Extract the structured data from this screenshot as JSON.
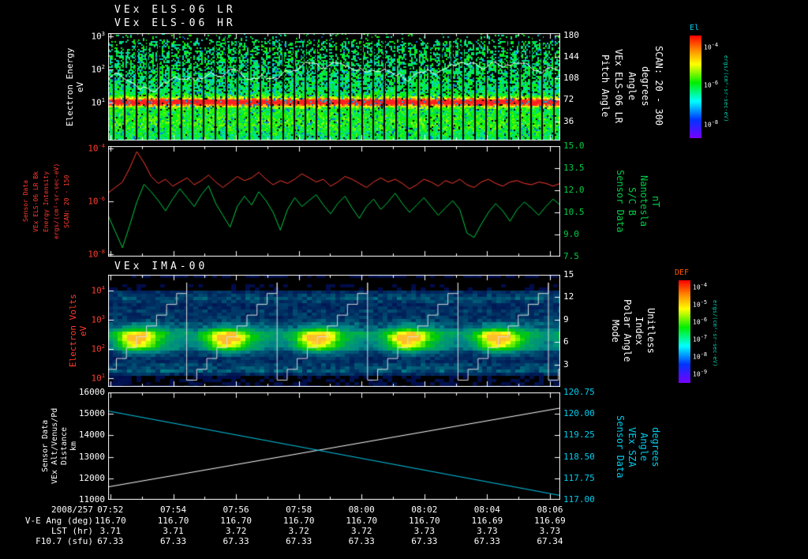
{
  "header": {
    "title_lr": "VEx ELS-06 LR",
    "title_hr": "VEx ELS-06 HR",
    "title_ima": "VEx IMA-00"
  },
  "colors": {
    "background": "#000000",
    "axis": "#ffffff",
    "red": "#ff3b2e",
    "green": "#00cc44",
    "cyan": "#00ccee",
    "def_title": "#ff5500"
  },
  "panels": {
    "p1": {
      "left_lines": [
        "Electron Energy",
        "eV"
      ],
      "right_lines": [
        "Pitch Angle",
        "VEx ELS-06 LR",
        "Angle",
        "degrees",
        "SCAN: 20 - 300"
      ],
      "left_ticks": [
        {
          "t": "10^3",
          "f": 0.03
        },
        {
          "t": "10^2",
          "f": 0.34
        },
        {
          "t": "10^1",
          "f": 0.65
        }
      ],
      "right_ticks": [
        {
          "t": "180",
          "f": 0.02
        },
        {
          "t": "144",
          "f": 0.22
        },
        {
          "t": "108",
          "f": 0.42
        },
        {
          "t": "72",
          "f": 0.62
        },
        {
          "t": "36",
          "f": 0.82
        }
      ]
    },
    "p2": {
      "left_lines": [
        "Sensor Data",
        "VEx ELS-06 LR Bk",
        "Energy Intensity",
        "ergs/(cm²-sr-sec-eV)",
        "SCAN: 20 - 150"
      ],
      "right_lines": [
        "Sensor Data",
        "S/C B",
        "Nanotesla",
        "nT"
      ],
      "left_ticks": [
        {
          "t": "10^-4",
          "f": 0.02
        },
        {
          "t": "10^-6",
          "f": 0.5
        },
        {
          "t": "10^-8",
          "f": 0.98
        }
      ],
      "right_ticks": [
        {
          "t": "15.0",
          "f": 0.0
        },
        {
          "t": "13.5",
          "f": 0.2
        },
        {
          "t": "12.0",
          "f": 0.4
        },
        {
          "t": "10.5",
          "f": 0.6
        },
        {
          "t": "9.0",
          "f": 0.8
        },
        {
          "t": "7.5",
          "f": 1.0
        }
      ]
    },
    "p3": {
      "left_lines": [
        "Electron Volts",
        "eV"
      ],
      "right_lines": [
        "Mode",
        "Polar Angle",
        "Index",
        "Unitless"
      ],
      "left_ticks": [
        {
          "t": "10^4",
          "f": 0.14
        },
        {
          "t": "10^3",
          "f": 0.4
        },
        {
          "t": "10^2",
          "f": 0.66
        },
        {
          "t": "10^1",
          "f": 0.92
        }
      ],
      "right_ticks": [
        {
          "t": "15",
          "f": 0.0
        },
        {
          "t": "12",
          "f": 0.2
        },
        {
          "t": "9",
          "f": 0.4
        },
        {
          "t": "6",
          "f": 0.6
        },
        {
          "t": "3",
          "f": 0.8
        }
      ]
    },
    "p4": {
      "left_lines": [
        "Sensor Data",
        "VEx Alt/Venus/Pd",
        "Distance",
        "km"
      ],
      "right_lines": [
        "Sensor Data",
        "VEx SZA",
        "Angle",
        "degrees"
      ],
      "left_ticks": [
        {
          "t": "16000",
          "f": 0.0
        },
        {
          "t": "15000",
          "f": 0.2
        },
        {
          "t": "14000",
          "f": 0.4
        },
        {
          "t": "13000",
          "f": 0.6
        },
        {
          "t": "12000",
          "f": 0.8
        },
        {
          "t": "11000",
          "f": 1.0
        }
      ],
      "right_ticks": [
        {
          "t": "120.75",
          "f": 0.0
        },
        {
          "t": "120.00",
          "f": 0.2
        },
        {
          "t": "119.25",
          "f": 0.4
        },
        {
          "t": "118.50",
          "f": 0.6
        },
        {
          "t": "117.75",
          "f": 0.8
        },
        {
          "t": "117.00",
          "f": 1.0
        }
      ]
    }
  },
  "colorbars": {
    "el": {
      "title": "El",
      "unit": "ergs/(cm²-sr-sec-eV)",
      "ticks": [
        {
          "t": "10^-4",
          "f": 0.1
        },
        {
          "t": "10^-6",
          "f": 0.47
        },
        {
          "t": "10^-8",
          "f": 0.85
        }
      ]
    },
    "def": {
      "title": "DEF",
      "unit": "ergs/(cm²-sr-sec-eV)",
      "ticks": [
        {
          "t": "10^-4",
          "f": 0.05
        },
        {
          "t": "10^-5",
          "f": 0.22
        },
        {
          "t": "10^-6",
          "f": 0.39
        },
        {
          "t": "10^-7",
          "f": 0.56
        },
        {
          "t": "10^-8",
          "f": 0.73
        },
        {
          "t": "10^-9",
          "f": 0.9
        }
      ]
    }
  },
  "time_axis": {
    "date": "2008/257",
    "ticks": [
      "07:52",
      "07:54",
      "07:56",
      "07:58",
      "08:00",
      "08:02",
      "08:04",
      "08:06"
    ]
  },
  "table": {
    "rows": [
      {
        "label": "V-E Ang (deg)",
        "values": [
          "116.70",
          "116.70",
          "116.70",
          "116.70",
          "116.70",
          "116.70",
          "116.69",
          "116.69"
        ]
      },
      {
        "label": "LST (hr)",
        "values": [
          "3.71",
          "3.71",
          "3.72",
          "3.72",
          "3.72",
          "3.73",
          "3.73",
          "3.73"
        ]
      },
      {
        "label": "F10.7 (sfu)",
        "values": [
          "67.33",
          "67.33",
          "67.33",
          "67.33",
          "67.33",
          "67.33",
          "67.33",
          "67.34"
        ]
      }
    ]
  },
  "chart_data": [
    {
      "type": "heatmap",
      "title": "VEx ELS-06 LR / VEx ELS-06 HR electron energy-time spectrogram",
      "ylabel": "Electron Energy (eV)",
      "yscale": "log",
      "y_range_eV": [
        3,
        1500
      ],
      "x_range": [
        "07:52",
        "08:06"
      ],
      "right_axis": {
        "label": "Pitch Angle (degrees)",
        "range": [
          0,
          180
        ],
        "note": "SCAN: 20 - 300"
      },
      "colorbar": {
        "label": "El",
        "units": "ergs/(cm²-sr-sec-eV)",
        "range_log10": [
          -8,
          -4
        ]
      },
      "features": [
        "intense red-orange band near 7-10 eV",
        "broad green/cyan flux 10-500 eV",
        "white pitch-angle trace oscillating across mid panel",
        "about 40 vertical scan segments"
      ]
    },
    {
      "type": "line",
      "x_range": [
        "07:52",
        "08:06"
      ],
      "series": [
        {
          "name": "VEx ELS-06 LR Bk Energy Intensity",
          "units": "ergs/(cm²-sr-sec-eV)",
          "color": "#ff3b2e",
          "scale": "log10",
          "ylim_log10": [
            -8,
            -4
          ],
          "values_log10": [
            -5.7,
            -5.5,
            -5.3,
            -4.8,
            -4.2,
            -4.6,
            -5.1,
            -5.35,
            -5.2,
            -5.45,
            -5.3,
            -5.15,
            -5.4,
            -5.25,
            -5.05,
            -5.3,
            -5.5,
            -5.3,
            -5.1,
            -5.25,
            -5.15,
            -4.95,
            -5.2,
            -5.4,
            -5.25,
            -5.35,
            -5.2,
            -5.0,
            -5.15,
            -5.3,
            -5.2,
            -5.45,
            -5.3,
            -5.1,
            -5.2,
            -5.35,
            -5.5,
            -5.3,
            -5.15,
            -5.3,
            -5.2,
            -5.35,
            -5.55,
            -5.4,
            -5.2,
            -5.3,
            -5.45,
            -5.25,
            -5.35,
            -5.2,
            -5.4,
            -5.5,
            -5.3,
            -5.2,
            -5.35,
            -5.45,
            -5.3,
            -5.25,
            -5.35,
            -5.4,
            -5.3,
            -5.35,
            -5.45,
            -5.35
          ]
        },
        {
          "name": "S/C B",
          "units": "nT",
          "color": "#00cc44",
          "ylim": [
            7.5,
            15
          ],
          "values": [
            10.3,
            9.2,
            8.1,
            9.6,
            11.2,
            12.4,
            11.9,
            11.3,
            10.6,
            11.4,
            12.1,
            11.5,
            10.9,
            11.7,
            12.3,
            11.1,
            10.3,
            9.5,
            10.9,
            11.6,
            11.0,
            11.9,
            11.3,
            10.5,
            9.3,
            10.7,
            11.5,
            10.9,
            11.3,
            11.7,
            11.0,
            10.4,
            11.1,
            11.6,
            10.8,
            10.1,
            10.9,
            11.4,
            10.7,
            11.2,
            11.8,
            11.1,
            10.5,
            11.0,
            11.5,
            10.9,
            10.3,
            10.8,
            11.3,
            10.7,
            9.1,
            8.8,
            9.7,
            10.5,
            11.1,
            10.6,
            9.9,
            10.7,
            11.2,
            10.8,
            10.3,
            10.9,
            11.4,
            11.0
          ]
        }
      ]
    },
    {
      "type": "heatmap",
      "title": "VEx IMA-00 energy-time spectrogram",
      "ylabel": "Electron Volts (eV)",
      "yscale": "log",
      "y_range_eV": [
        10,
        30000
      ],
      "x_range": [
        "07:52",
        "08:06"
      ],
      "right_axis": {
        "label": "Mode / Polar Angle Index (Unitless)",
        "range": [
          0,
          15
        ]
      },
      "colorbar": {
        "label": "DEF",
        "units": "ergs/(cm²-sr-sec-eV)",
        "range_log10": [
          -9,
          -4
        ]
      },
      "features": [
        "5 repeating scan cycles",
        "bright green-yellow ion blobs near a few hundred eV each cycle",
        "white stepped polar-angle sawtooth line per cycle"
      ]
    },
    {
      "type": "line",
      "x_range": [
        "07:52",
        "08:06"
      ],
      "series": [
        {
          "name": "VEx Alt/Venus/Pd Distance",
          "units": "km",
          "color": "#ffffff",
          "ylim": [
            11000,
            16000
          ],
          "values": [
            11600,
            15270
          ]
        },
        {
          "name": "VEx SZA",
          "units": "degrees",
          "color": "#00ccee",
          "ylim": [
            117.0,
            120.75
          ],
          "values": [
            120.1,
            117.15
          ]
        }
      ]
    }
  ]
}
